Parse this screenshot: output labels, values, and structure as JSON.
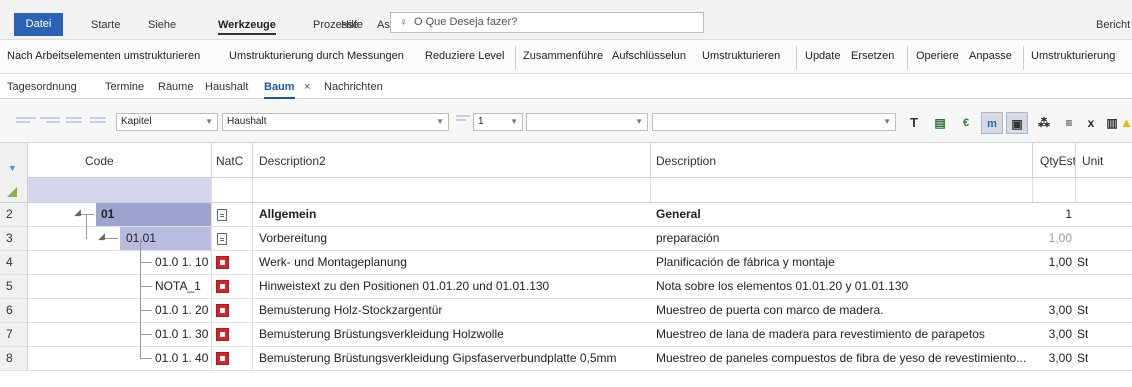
{
  "ribbon": {
    "tabs": [
      "Datei",
      "Starte",
      "Siehe",
      "Werkzeuge",
      "Prozesse",
      "Assistenten",
      "Hilfe"
    ],
    "active_tab": "Werkzeuge",
    "tell_me": "O Que Deseja fazer?",
    "right_label": "Bericht"
  },
  "commands": {
    "group1": [
      "Nach Arbeitselementen umstrukturieren",
      "Umstrukturierung durch Messungen",
      "Reduziere Level"
    ],
    "group2": [
      "Zusammenführe",
      "Aufschlüsselun",
      "Umstrukturieren"
    ],
    "group3": [
      "Update",
      "Ersetzen"
    ],
    "group4": [
      "Operiere",
      "Anpasse"
    ],
    "group5": [
      "Umstrukturierung"
    ]
  },
  "doc_tabs": {
    "items": [
      "Tagesordnung",
      "Termine",
      "Räume",
      "Haushalt",
      "Baum",
      "Nachrichten"
    ],
    "active": "Baum",
    "close_glyph": "×"
  },
  "toolbar": {
    "select_level": "Kapitel",
    "select_budget": "Haushalt",
    "select_number": "1",
    "select_empty_1": "",
    "select_empty_2": "",
    "icons": [
      "text-bold-icon",
      "summary-icon",
      "price-icon",
      "measurement-icon",
      "copy-icon",
      "tree-icon",
      "multiply-icon",
      "formula-icon",
      "document-icon",
      "warning-icon",
      "euro-icon",
      "function-icon"
    ]
  },
  "grid": {
    "columns": {
      "code": "Code",
      "natc": "NatC",
      "description2": "Description2",
      "description": "Description",
      "qtyest": "QtyEst",
      "unit": "Unit"
    },
    "rows": [
      {
        "num": "2",
        "code": "01",
        "natc": "doc",
        "description2": "Allgemein",
        "description": "General",
        "qty": "1",
        "unit": "",
        "level": 0,
        "bold": true
      },
      {
        "num": "3",
        "code": "01.01",
        "natc": "doc",
        "description2": "Vorbereitung",
        "description": "preparación",
        "qty": "1,00",
        "unit": "",
        "level": 1,
        "bold": false
      },
      {
        "num": "4",
        "code": "01.0 1. 10",
        "natc": "red",
        "description2": "Werk- und Montageplanung",
        "description": "Planificación de fábrica y montaje",
        "qty": "1,00",
        "unit": "St",
        "level": 2,
        "bold": false
      },
      {
        "num": "5",
        "code": "NOTA_1",
        "natc": "red",
        "description2": "Hinweistext zu den Positionen 01.01.20 und 01.01.130",
        "description": "Nota sobre los elementos 01.01.20 y 01.01.130",
        "qty": "",
        "unit": "",
        "level": 2,
        "bold": false
      },
      {
        "num": "6",
        "code": "01.0 1. 20",
        "natc": "red",
        "description2": "Bemusterung Holz-Stockzargentür",
        "description": "Muestreo de puerta con marco de madera.",
        "qty": "3,00",
        "unit": "St",
        "level": 2,
        "bold": false
      },
      {
        "num": "7",
        "code": "01.0 1. 30",
        "natc": "red",
        "description2": "Bemusterung Brüstungsverkleidung Holzwolle",
        "description": "Muestreo de lana de madera para revestimiento de parapetos",
        "qty": "3,00",
        "unit": "St",
        "level": 2,
        "bold": false
      },
      {
        "num": "8",
        "code": "01.0 1. 40",
        "natc": "red",
        "description2": "Bemusterung Brüstungsverkleidung Gipsfaserverbundplatte 0,5mm",
        "description": "Muestreo de paneles compuestos de fibra de yeso de revestimiento...",
        "qty": "3,00",
        "unit": "St",
        "level": 2,
        "bold": false
      }
    ]
  },
  "colors": {
    "file_tab": "#2b62b6",
    "level0_code": "#9ea2cf",
    "level1_code": "#b9bce0",
    "filter_code": "#d4d6ee",
    "natc_red": "#d8232a",
    "active_doc_tab": "#1e56a8"
  }
}
